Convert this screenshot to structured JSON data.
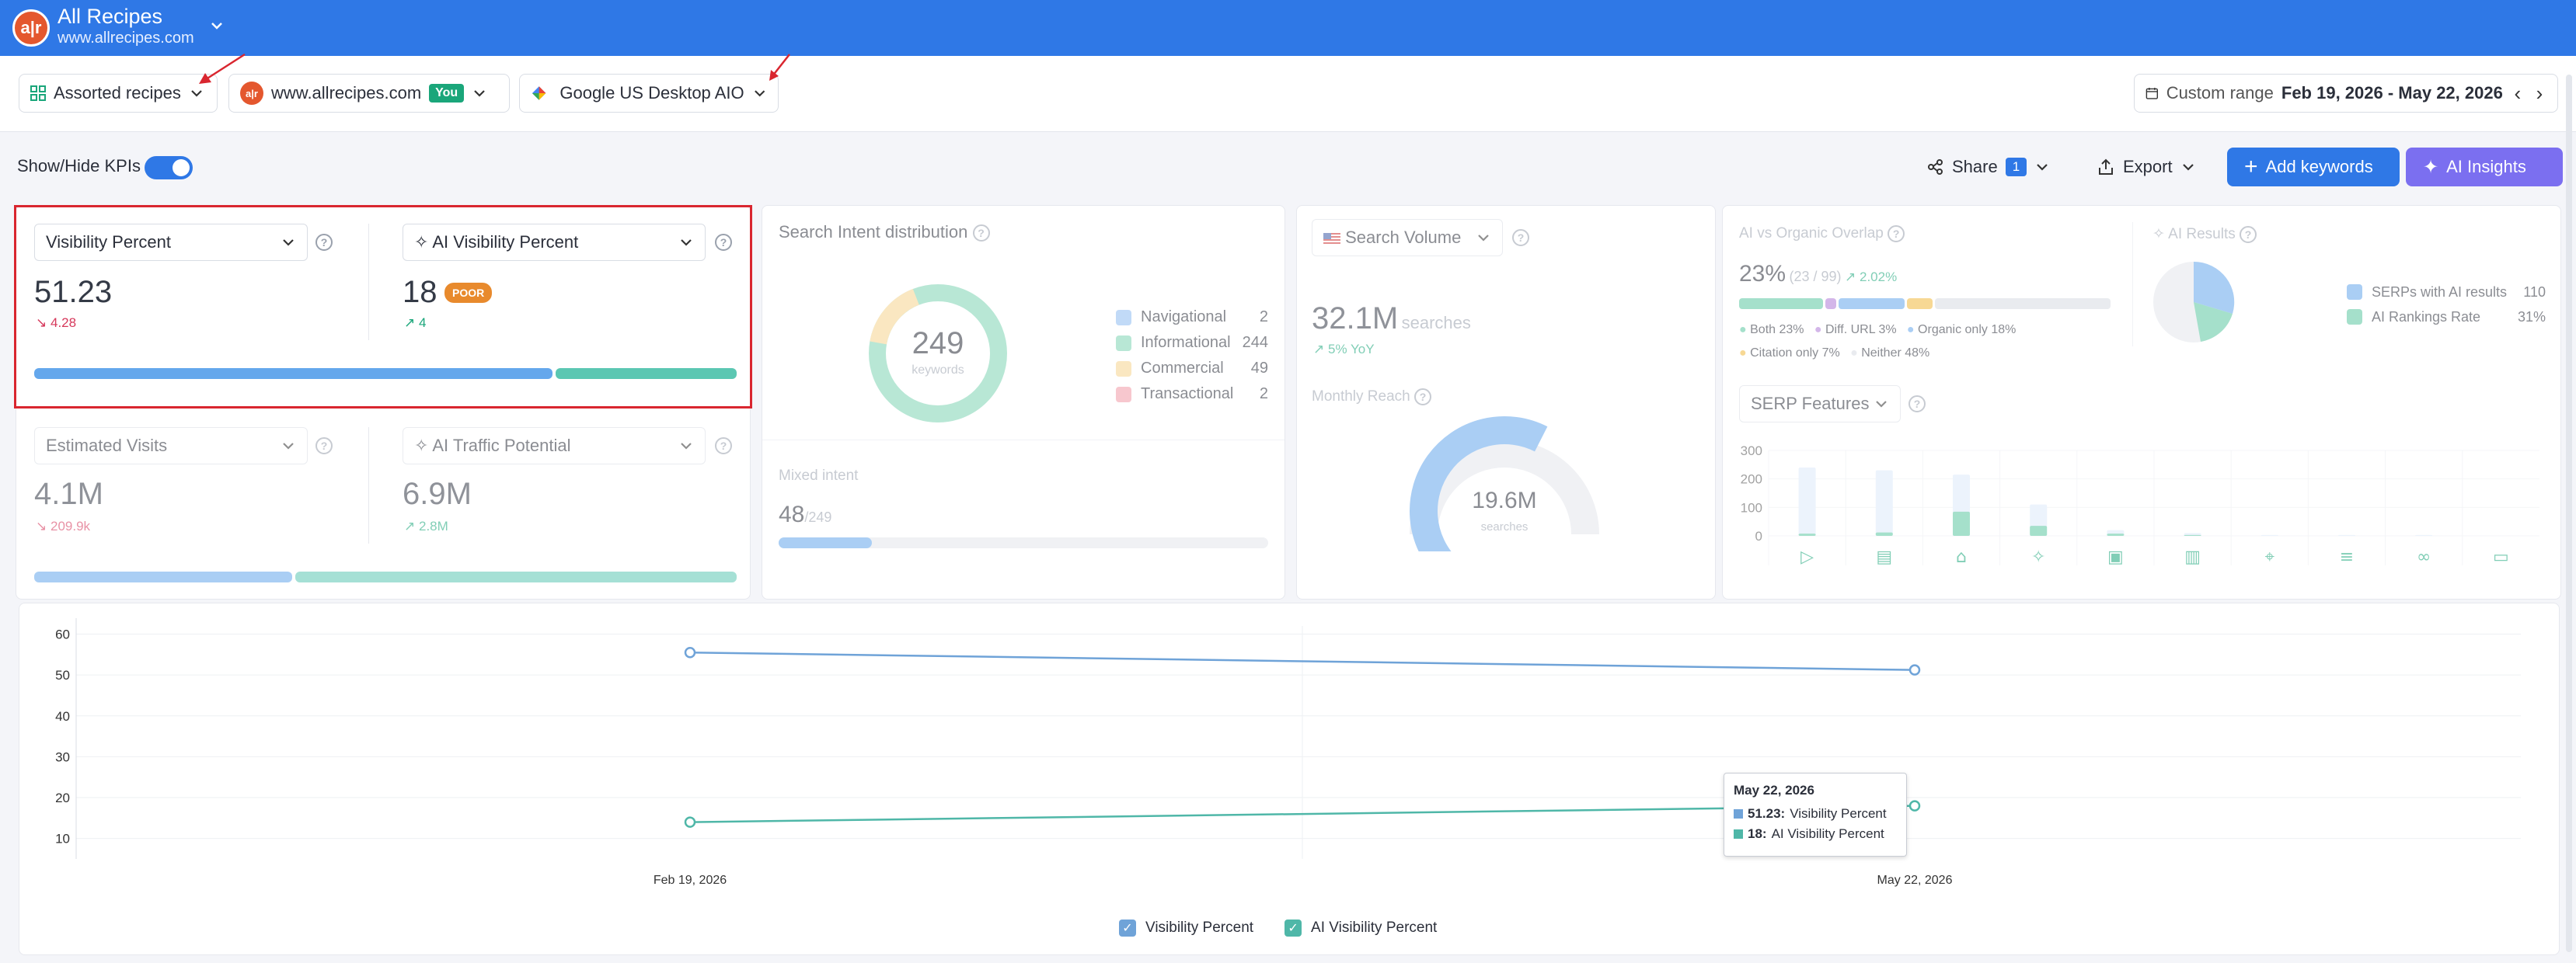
{
  "header": {
    "app_title": "All Recipes",
    "app_url": "www.allrecipes.com",
    "logo_text": "a|r"
  },
  "filters": {
    "group": "Assorted recipes",
    "domain": "www.allrecipes.com",
    "domain_badge": "You",
    "engine": "Google US Desktop AIO",
    "range_label": "Custom range",
    "range_value": "Feb 19, 2026 - May 22, 2026"
  },
  "actions": {
    "kpi_toggle_label": "Show/Hide KPIs",
    "share": "Share",
    "share_count": "1",
    "export": "Export",
    "add_keywords": "Add keywords",
    "ai_insights": "AI Insights"
  },
  "kpis": {
    "visibility": {
      "label": "Visibility Percent",
      "value": "51.23",
      "delta": "4.28",
      "bar_fraction": 0.74
    },
    "ai_visibility": {
      "label": "AI Visibility Percent",
      "value": "18",
      "badge": "POOR",
      "delta": "4"
    },
    "visits": {
      "label": "Estimated Visits",
      "value": "4.1M",
      "delta": "209.9k",
      "bar_fraction": 0.37
    },
    "ai_traffic": {
      "label": "AI Traffic Potential",
      "value": "6.9M",
      "delta": "2.8M"
    }
  },
  "intent": {
    "title": "Search Intent distribution",
    "total": "249",
    "total_label": "keywords",
    "items": [
      {
        "label": "Navigational",
        "count": "2",
        "color": "#8ebcf0"
      },
      {
        "label": "Informational",
        "count": "244",
        "color": "#7fd3b3"
      },
      {
        "label": "Commercial",
        "count": "49",
        "color": "#f6d38f"
      },
      {
        "label": "Transactional",
        "count": "2",
        "color": "#f19aa6"
      }
    ],
    "mixed_label": "Mixed intent",
    "mixed_value": "48",
    "mixed_total": "/249",
    "mixed_fraction": 0.19
  },
  "volume": {
    "selector": "Search Volume",
    "value": "32.1M",
    "unit": "searches",
    "yoy": "5% YoY",
    "reach_label": "Monthly Reach",
    "reach_value": "19.6M",
    "reach_unit": "searches",
    "reach_fraction": 0.6
  },
  "overlap": {
    "title": "AI vs Organic Overlap",
    "value": "23%",
    "ratio": "(23 / 99)",
    "delta": "2.02%",
    "legend": [
      {
        "label": "Both 23%",
        "color": "#5bc7a0",
        "share": 23
      },
      {
        "label": "Diff. URL 3%",
        "color": "#b07ad8",
        "share": 3
      },
      {
        "label": "Organic only 18%",
        "color": "#64a7ec",
        "share": 18
      },
      {
        "label": "Citation only 7%",
        "color": "#f0b83c",
        "share": 7
      },
      {
        "label": "Neither 48%",
        "color": "#d7dbe2",
        "share": 48
      }
    ]
  },
  "ai_results": {
    "title": "AI Results",
    "rows": [
      {
        "label": "SERPs with AI results",
        "value": "110",
        "color": "#64a7ec"
      },
      {
        "label": "AI Rankings Rate",
        "value": "31%",
        "color": "#5bc7a0"
      }
    ]
  },
  "serp": {
    "selector": "SERP Features",
    "icons": [
      "video-icon",
      "reviews-icon",
      "recipe-icon",
      "ai-overview-icon",
      "image-icon",
      "knowledge-icon",
      "local-pack-icon",
      "filter-icon",
      "link-icon",
      "discussion-icon"
    ]
  },
  "chart_data": [
    {
      "type": "bar",
      "title": "SERP Features",
      "ylim": [
        0,
        300
      ],
      "yticks": [
        "300",
        "200",
        "100",
        "0"
      ],
      "categories": [
        "Video",
        "Reviews",
        "Recipes",
        "AI Overview",
        "Images",
        "Knowledge",
        "Local pack",
        "Filters",
        "Sitelinks",
        "Discussions"
      ],
      "series": [
        {
          "values": [
            240,
            230,
            215,
            110,
            20,
            10,
            3,
            3,
            3,
            0
          ],
          "color": "#dce9fa"
        },
        {
          "values": [
            8,
            12,
            85,
            35,
            8,
            3,
            0,
            0,
            0,
            0
          ],
          "color": "#5bc7a0"
        }
      ]
    },
    {
      "type": "line",
      "x": [
        "Feb 19, 2026",
        "May 22, 2026"
      ],
      "ylim": [
        5,
        62
      ],
      "yticks": [
        "60",
        "50",
        "40",
        "30",
        "20",
        "10"
      ],
      "series": [
        {
          "name": "Visibility Percent",
          "values": [
            55.5,
            51.23
          ],
          "color": "#6fa3d8"
        },
        {
          "name": "AI Visibility Percent",
          "values": [
            14,
            18
          ],
          "color": "#4fb7a8"
        }
      ],
      "tooltip": {
        "date": "May 22, 2026",
        "rows": [
          {
            "value": "51.23:",
            "label": "Visibility Percent"
          },
          {
            "value": "18:",
            "label": "AI Visibility Percent"
          }
        ]
      },
      "legend": [
        "Visibility Percent",
        "AI Visibility Percent"
      ]
    }
  ]
}
